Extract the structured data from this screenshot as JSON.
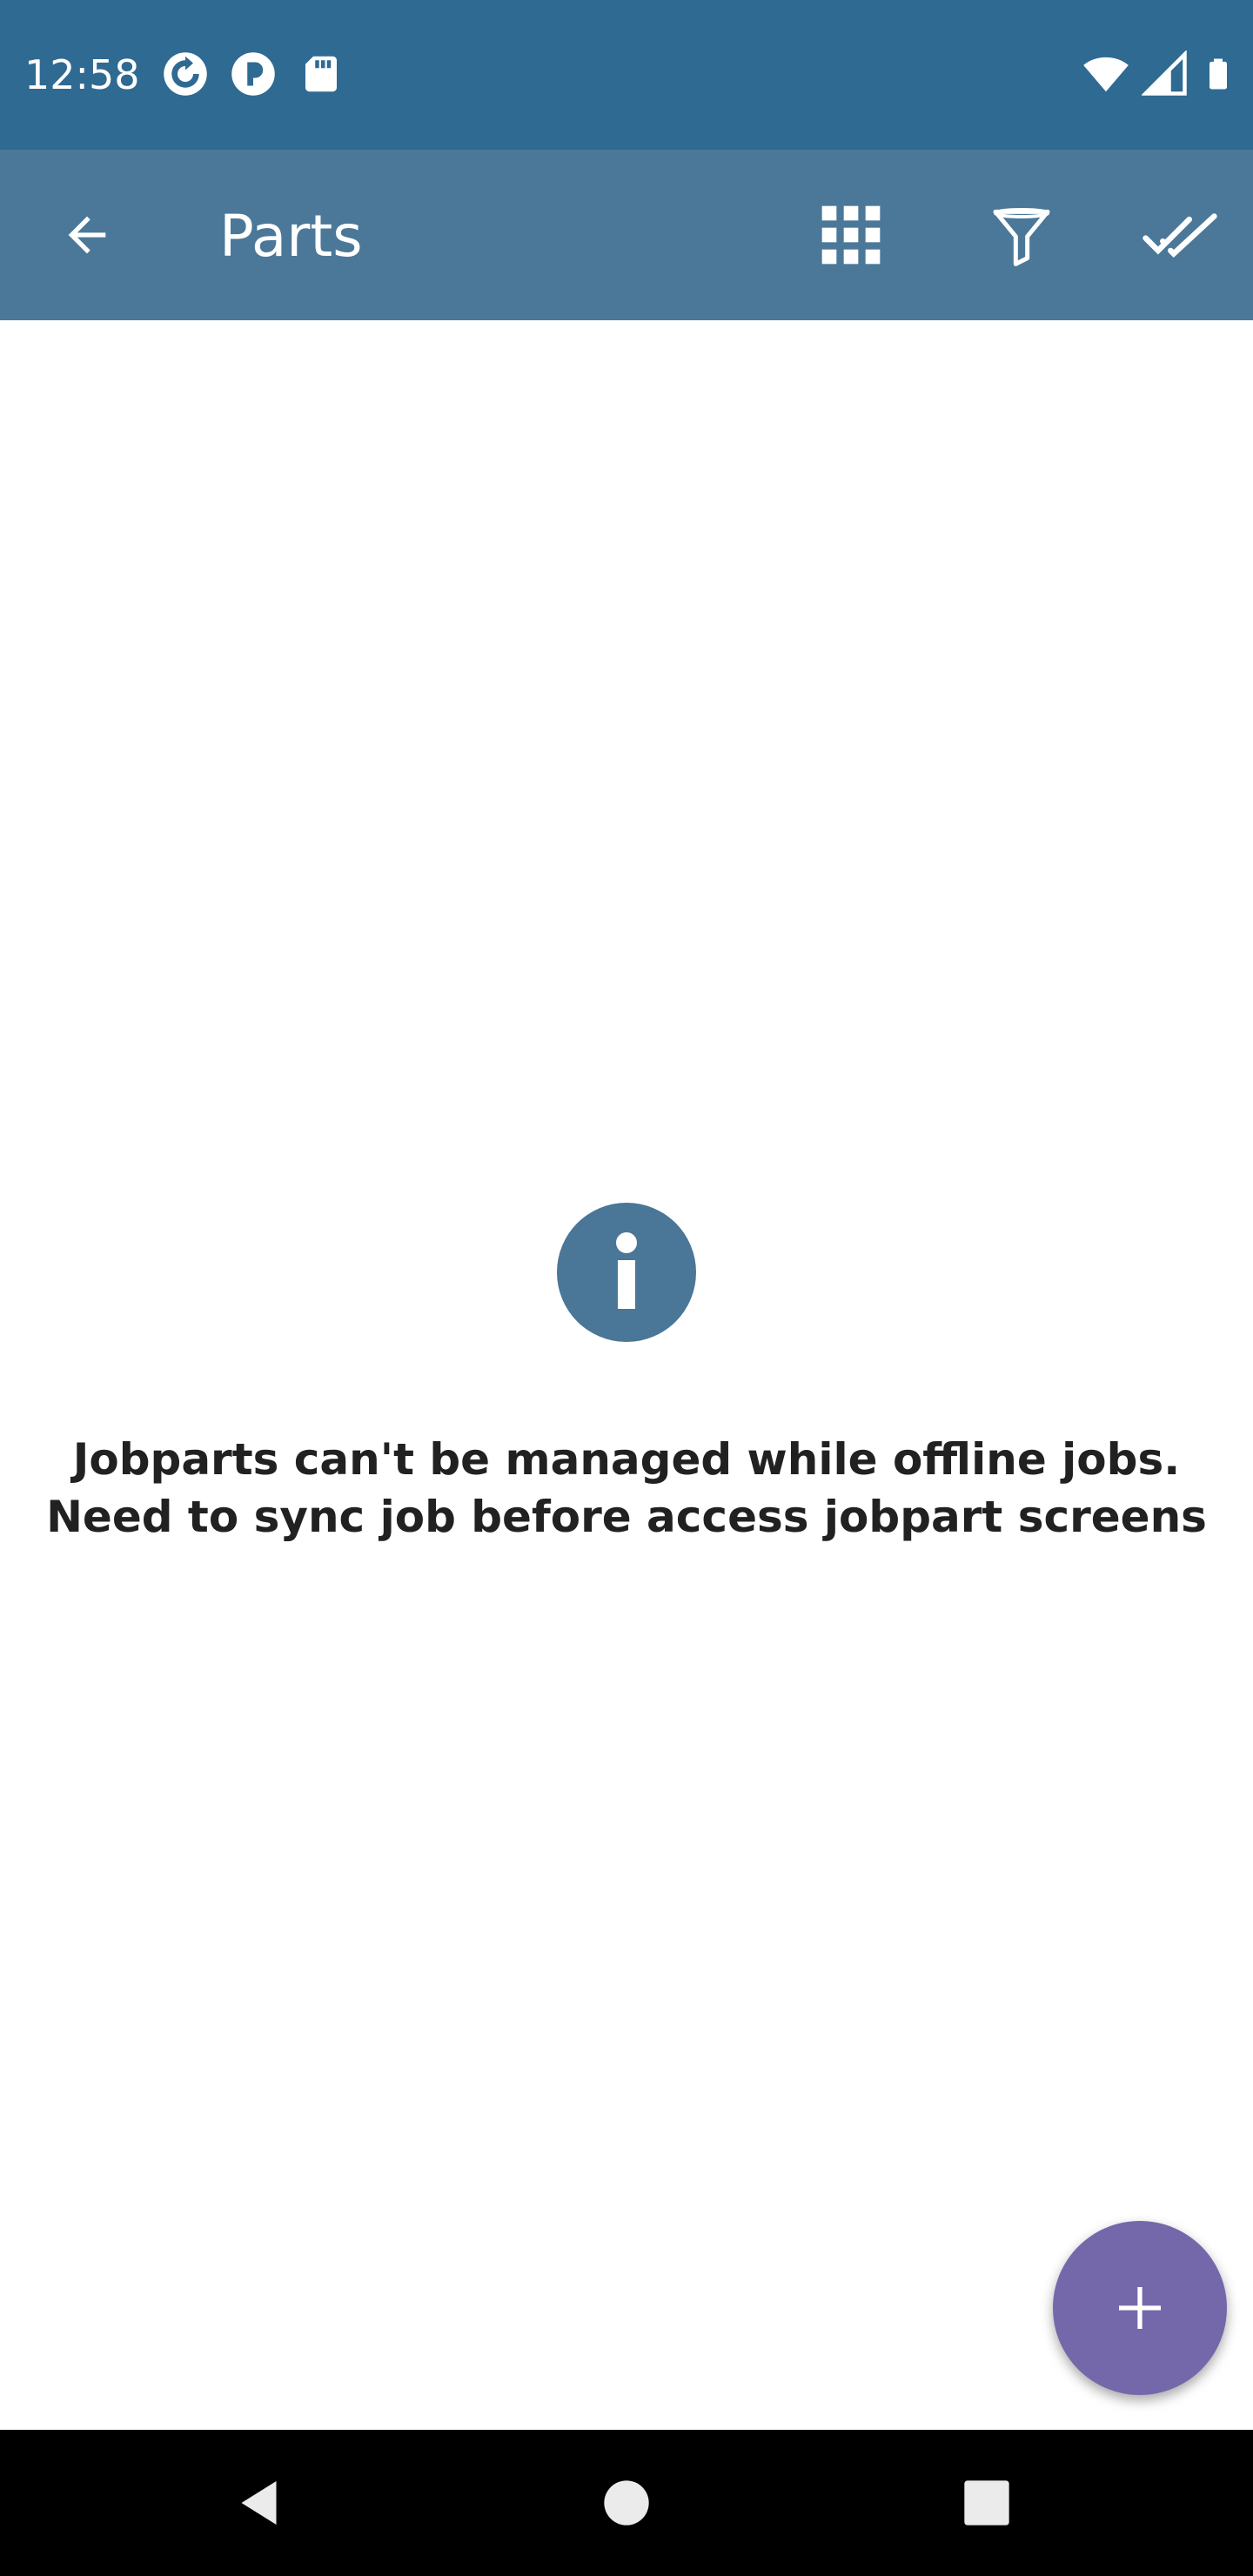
{
  "status_bar": {
    "time": "12:58",
    "left_icons": [
      "sync-icon",
      "data-saver-icon",
      "sd-card-icon"
    ],
    "right_icons": [
      "wifi-icon",
      "signal-icon",
      "battery-icon"
    ]
  },
  "app_bar": {
    "title": "Parts",
    "back_icon": "arrow-back-icon",
    "actions": [
      "grid-view-icon",
      "filter-icon",
      "done-all-icon"
    ]
  },
  "content": {
    "info_icon": "info-icon",
    "message": "Jobparts can't be managed while offline jobs. Need to sync job before access jobpart screens"
  },
  "fab": {
    "icon": "add-icon"
  },
  "nav_bar": {
    "buttons": [
      "back-triangle-icon",
      "home-circle-icon",
      "recents-square-icon"
    ]
  },
  "colors": {
    "status_bar": "#2f6a92",
    "app_bar": "#4b7899",
    "info_icon": "#4a7697",
    "fab": "#7468ab",
    "message_text": "#212121"
  }
}
